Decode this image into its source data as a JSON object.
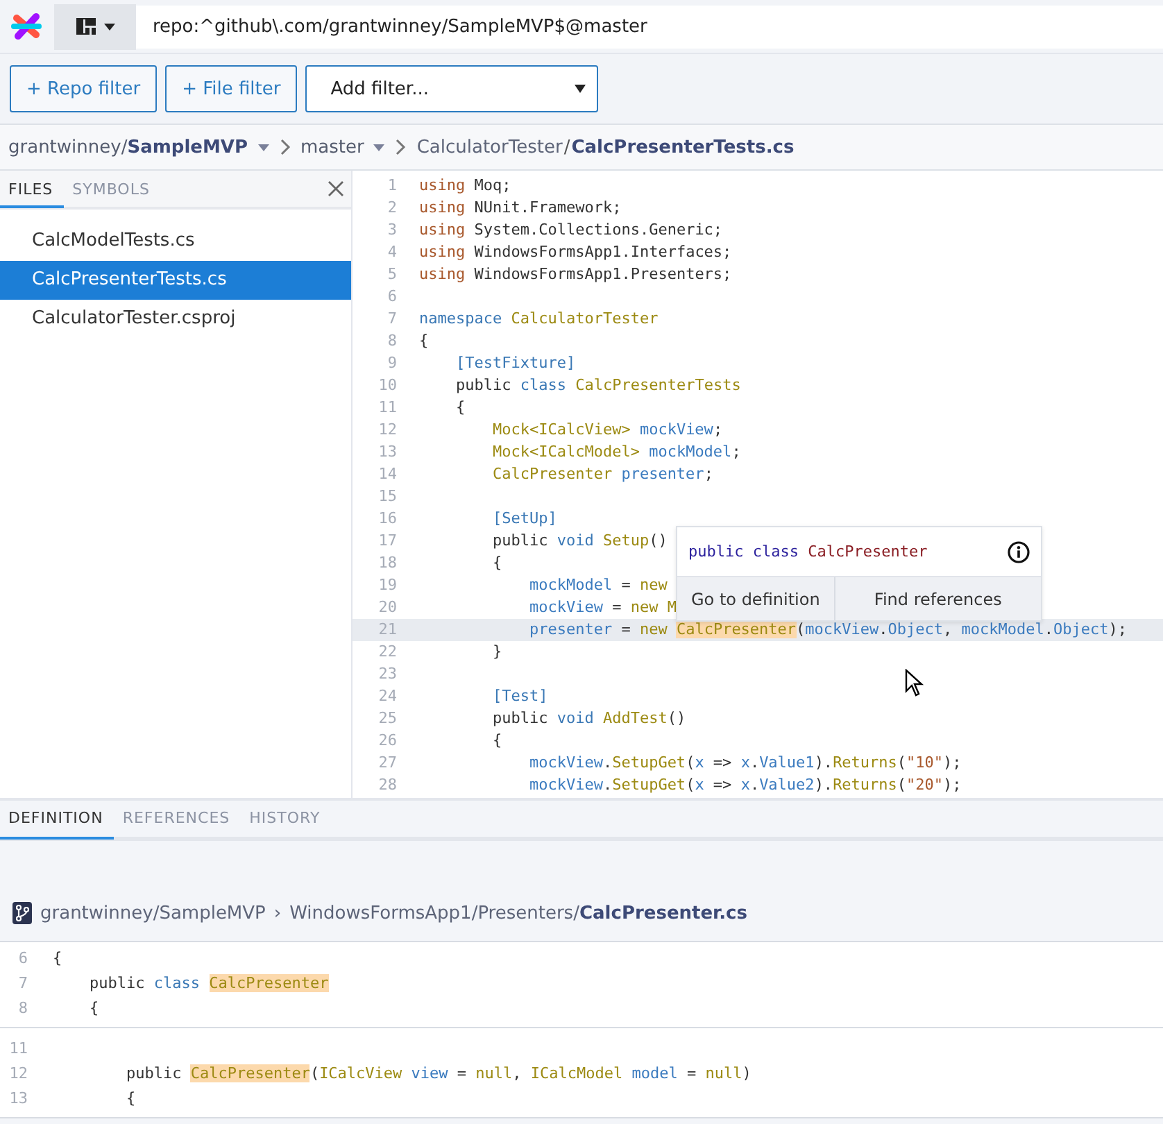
{
  "search": {
    "value": "repo:^github\\.com/grantwinney/SampleMVP$@master"
  },
  "filters": {
    "buttons": [
      "+ Repo filter",
      "+ File filter"
    ],
    "select": "Add filter..."
  },
  "breadcrumb": {
    "owner": "grantwinney/",
    "repo": "SampleMVP",
    "branch": "master",
    "folder": "CalculatorTester",
    "separator": "/",
    "file": "CalcPresenterTests.cs"
  },
  "sidebar": {
    "tabs": [
      {
        "label": "FILES",
        "selected": true
      },
      {
        "label": "SYMBOLS",
        "selected": false
      }
    ],
    "files": [
      {
        "name": "CalcModelTests.cs",
        "selected": false
      },
      {
        "name": "CalcPresenterTests.cs",
        "selected": true
      },
      {
        "name": "CalculatorTester.csproj",
        "selected": false
      }
    ]
  },
  "code": {
    "lines": [
      {
        "num": "1",
        "current": false,
        "tokens": [
          {
            "text": "using",
            "kind": "kw"
          },
          {
            "text": " Moq;",
            "kind": "plain"
          }
        ]
      },
      {
        "num": "2",
        "current": false,
        "tokens": [
          {
            "text": "using",
            "kind": "kw"
          },
          {
            "text": " NUnit.Framework;",
            "kind": "plain"
          }
        ]
      },
      {
        "num": "3",
        "current": false,
        "tokens": [
          {
            "text": "using",
            "kind": "kw"
          },
          {
            "text": " System.Collections.Generic;",
            "kind": "plain"
          }
        ]
      },
      {
        "num": "4",
        "current": false,
        "tokens": [
          {
            "text": "using",
            "kind": "kw"
          },
          {
            "text": " WindowsFormsApp1.Interfaces;",
            "kind": "plain"
          }
        ]
      },
      {
        "num": "5",
        "current": false,
        "tokens": [
          {
            "text": "using",
            "kind": "kw"
          },
          {
            "text": " WindowsFormsApp1.Presenters;",
            "kind": "plain"
          }
        ]
      },
      {
        "num": "6",
        "current": false
      },
      {
        "num": "7",
        "current": false,
        "tokens": [
          {
            "text": "namespace",
            "kind": "blue"
          },
          {
            "text": " CalculatorTester",
            "kind": "type"
          }
        ]
      },
      {
        "num": "8",
        "current": false,
        "tokens": [
          {
            "text": "{",
            "kind": "plain"
          }
        ]
      },
      {
        "num": "9",
        "current": false,
        "tokens": [
          {
            "text": "    [TestFixture]",
            "kind": "blue"
          }
        ]
      },
      {
        "num": "10",
        "current": false,
        "tokens": [
          {
            "text": "    public ",
            "kind": "plain"
          },
          {
            "text": "class",
            "kind": "blue"
          },
          {
            "text": " CalcPresenterTests",
            "kind": "type"
          }
        ]
      },
      {
        "num": "11",
        "current": false,
        "tokens": [
          {
            "text": "    {",
            "kind": "plain"
          }
        ]
      },
      {
        "num": "12",
        "current": false,
        "tokens": [
          {
            "text": "        Mock<ICalcView>",
            "kind": "type"
          },
          {
            "text": " mockView",
            "kind": "var"
          },
          {
            "text": ";",
            "kind": "plain"
          }
        ]
      },
      {
        "num": "13",
        "current": false,
        "tokens": [
          {
            "text": "        Mock<ICalcModel>",
            "kind": "type"
          },
          {
            "text": " mockModel",
            "kind": "var"
          },
          {
            "text": ";",
            "kind": "plain"
          }
        ]
      },
      {
        "num": "14",
        "current": false,
        "tokens": [
          {
            "text": "        CalcPresenter",
            "kind": "type"
          },
          {
            "text": " presenter",
            "kind": "var"
          },
          {
            "text": ";",
            "kind": "plain"
          }
        ]
      },
      {
        "num": "15",
        "current": false
      },
      {
        "num": "16",
        "current": false,
        "tokens": [
          {
            "text": "        [SetUp]",
            "kind": "blue"
          }
        ]
      },
      {
        "num": "17",
        "current": false,
        "tokens": [
          {
            "text": "        public ",
            "kind": "plain"
          },
          {
            "text": "void",
            "kind": "blue"
          },
          {
            "text": " Setup",
            "kind": "type"
          },
          {
            "text": "()",
            "kind": "plain"
          }
        ]
      },
      {
        "num": "18",
        "current": false,
        "tokens": [
          {
            "text": "        {",
            "kind": "plain"
          }
        ]
      },
      {
        "num": "19",
        "current": false,
        "tokens": [
          {
            "text": "            mockModel",
            "kind": "var"
          },
          {
            "text": " = ",
            "kind": "plain"
          },
          {
            "text": "new",
            "kind": "type"
          }
        ]
      },
      {
        "num": "20",
        "current": false,
        "tokens": [
          {
            "text": "            mockView",
            "kind": "var"
          },
          {
            "text": " = ",
            "kind": "plain"
          },
          {
            "text": "new M",
            "kind": "type"
          }
        ]
      },
      {
        "num": "21",
        "current": true,
        "tokens": [
          {
            "text": "            presenter",
            "kind": "var"
          },
          {
            "text": " = ",
            "kind": "plain"
          },
          {
            "text": "new ",
            "kind": "type"
          },
          {
            "text": "CalcPresenter",
            "kind": "match"
          },
          {
            "text": "(",
            "kind": "plain"
          },
          {
            "text": "mockView",
            "kind": "var"
          },
          {
            "text": ".",
            "kind": "plain"
          },
          {
            "text": "Object",
            "kind": "var"
          },
          {
            "text": ", ",
            "kind": "plain"
          },
          {
            "text": "mockModel",
            "kind": "var"
          },
          {
            "text": ".",
            "kind": "plain"
          },
          {
            "text": "Object",
            "kind": "var"
          },
          {
            "text": ");",
            "kind": "plain"
          }
        ]
      },
      {
        "num": "22",
        "current": false,
        "tokens": [
          {
            "text": "        }",
            "kind": "plain"
          }
        ]
      },
      {
        "num": "23",
        "current": false
      },
      {
        "num": "24",
        "current": false,
        "tokens": [
          {
            "text": "        [Test]",
            "kind": "blue"
          }
        ]
      },
      {
        "num": "25",
        "current": false,
        "tokens": [
          {
            "text": "        public ",
            "kind": "plain"
          },
          {
            "text": "void",
            "kind": "blue"
          },
          {
            "text": " AddTest",
            "kind": "type"
          },
          {
            "text": "()",
            "kind": "plain"
          }
        ]
      },
      {
        "num": "26",
        "current": false,
        "tokens": [
          {
            "text": "        {",
            "kind": "plain"
          }
        ]
      },
      {
        "num": "27",
        "current": false,
        "tokens": [
          {
            "text": "            mockView",
            "kind": "var"
          },
          {
            "text": ".",
            "kind": "plain"
          },
          {
            "text": "SetupGet",
            "kind": "type"
          },
          {
            "text": "(",
            "kind": "plain"
          },
          {
            "text": "x",
            "kind": "var"
          },
          {
            "text": " => ",
            "kind": "plain"
          },
          {
            "text": "x",
            "kind": "var"
          },
          {
            "text": ".",
            "kind": "plain"
          },
          {
            "text": "Value1",
            "kind": "var"
          },
          {
            "text": ").",
            "kind": "plain"
          },
          {
            "text": "Returns",
            "kind": "type"
          },
          {
            "text": "(",
            "kind": "plain"
          },
          {
            "text": "\"10\"",
            "kind": "str"
          },
          {
            "text": ");",
            "kind": "plain"
          }
        ]
      },
      {
        "num": "28",
        "current": false,
        "tokens": [
          {
            "text": "            mockView",
            "kind": "var"
          },
          {
            "text": ".",
            "kind": "plain"
          },
          {
            "text": "SetupGet",
            "kind": "type"
          },
          {
            "text": "(",
            "kind": "plain"
          },
          {
            "text": "x",
            "kind": "var"
          },
          {
            "text": " => ",
            "kind": "plain"
          },
          {
            "text": "x",
            "kind": "var"
          },
          {
            "text": ".",
            "kind": "plain"
          },
          {
            "text": "Value2",
            "kind": "var"
          },
          {
            "text": ").",
            "kind": "plain"
          },
          {
            "text": "Returns",
            "kind": "type"
          },
          {
            "text": "(",
            "kind": "plain"
          },
          {
            "text": "\"20\"",
            "kind": "str"
          },
          {
            "text": ");",
            "kind": "plain"
          }
        ]
      }
    ]
  },
  "hover": {
    "signature": [
      {
        "text": "public class",
        "kind": "keyword"
      },
      {
        "text": " CalcPresenter",
        "kind": "name"
      }
    ],
    "actions": [
      "Go to definition",
      "Find references"
    ]
  },
  "panel": {
    "tabs": [
      {
        "label": "DEFINITION",
        "selected": true
      },
      {
        "label": "REFERENCES",
        "selected": false
      },
      {
        "label": "HISTORY",
        "selected": false
      }
    ],
    "path": {
      "repo": "grantwinney/SampleMVP",
      "separator": "›",
      "folder": "WindowsFormsApp1/Presenters/",
      "file": "CalcPresenter.cs"
    },
    "hunks": [
      {
        "lines": [
          {
            "num": "6",
            "current": false,
            "tokens": [
              {
                "text": "{",
                "kind": "plain"
              }
            ]
          },
          {
            "num": "7",
            "current": false,
            "tokens": [
              {
                "text": "    public ",
                "kind": "plain"
              },
              {
                "text": "class ",
                "kind": "blue"
              },
              {
                "text": "CalcPresenter",
                "kind": "match"
              }
            ]
          },
          {
            "num": "8",
            "current": false,
            "tokens": [
              {
                "text": "    {",
                "kind": "plain"
              }
            ]
          }
        ]
      },
      {
        "lines": [
          {
            "num": "11",
            "current": false
          },
          {
            "num": "12",
            "current": false,
            "tokens": [
              {
                "text": "        public ",
                "kind": "plain"
              },
              {
                "text": "CalcPresenter",
                "kind": "match"
              },
              {
                "text": "(",
                "kind": "plain"
              },
              {
                "text": "ICalcView",
                "kind": "type"
              },
              {
                "text": " view",
                "kind": "var"
              },
              {
                "text": " = ",
                "kind": "plain"
              },
              {
                "text": "null",
                "kind": "type"
              },
              {
                "text": ", ",
                "kind": "plain"
              },
              {
                "text": "ICalcModel",
                "kind": "type"
              },
              {
                "text": " model",
                "kind": "var"
              },
              {
                "text": " = ",
                "kind": "plain"
              },
              {
                "text": "null",
                "kind": "type"
              },
              {
                "text": ")",
                "kind": "plain"
              }
            ]
          },
          {
            "num": "13",
            "current": false,
            "tokens": [
              {
                "text": "        {",
                "kind": "plain"
              }
            ]
          }
        ]
      }
    ]
  }
}
